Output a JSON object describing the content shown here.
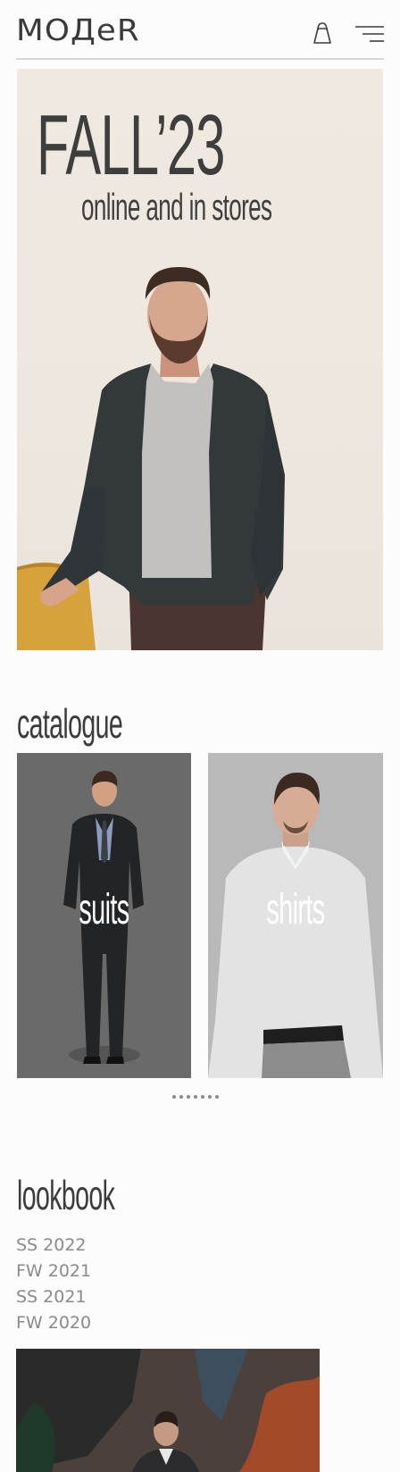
{
  "header": {
    "logo": "MOДeR",
    "bag_icon": "shopping-bag-icon",
    "menu_icon": "hamburger-menu-icon"
  },
  "hero": {
    "title": "FALL’23",
    "subtitle": "online and in stores"
  },
  "catalogue": {
    "title": "catalogue",
    "items": [
      {
        "label": "suits"
      },
      {
        "label": "shirts"
      }
    ],
    "pagination_dots": 7
  },
  "lookbook": {
    "title": "lookbook",
    "collections": [
      "SS 2022",
      "FW 2021",
      "SS 2021",
      "FW 2020"
    ]
  },
  "colors": {
    "text": "#3d3d3d",
    "muted": "#8a8a8a",
    "hero_bg": "#ede7de"
  }
}
